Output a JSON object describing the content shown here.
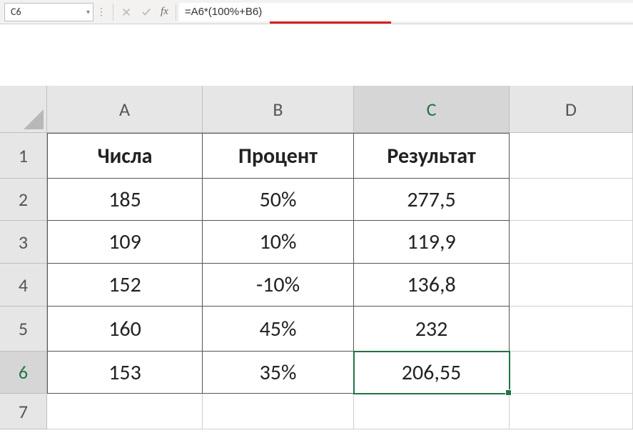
{
  "name_box": "C6",
  "formula": "=A6*(100%+B6)",
  "fx_label": "fx",
  "columns": [
    "A",
    "B",
    "C",
    "D"
  ],
  "active_col": "C",
  "rows": [
    "1",
    "2",
    "3",
    "4",
    "5",
    "6",
    "7"
  ],
  "active_row": "6",
  "selected_cell": "C6",
  "headers": {
    "A": "Числа",
    "B": "Процент",
    "C": "Результат"
  },
  "data": [
    {
      "A": "185",
      "B": "50%",
      "C": "277,5"
    },
    {
      "A": "109",
      "B": "10%",
      "C": "119,9"
    },
    {
      "A": "152",
      "B": "-10%",
      "C": "136,8"
    },
    {
      "A": "160",
      "B": "45%",
      "C": "232"
    },
    {
      "A": "153",
      "B": "35%",
      "C": "206,55"
    }
  ]
}
